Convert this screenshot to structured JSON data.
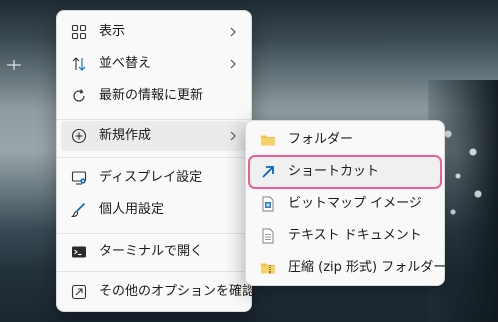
{
  "main_menu": {
    "items": [
      {
        "label": "表示",
        "icon": "view-grid-icon",
        "submenu": true
      },
      {
        "label": "並べ替え",
        "icon": "sort-icon",
        "submenu": true
      },
      {
        "label": "最新の情報に更新",
        "icon": "refresh-icon",
        "submenu": false
      },
      {
        "label": "新規作成",
        "icon": "new-plus-icon",
        "submenu": true,
        "active": true
      },
      {
        "label": "ディスプレイ設定",
        "icon": "display-settings-icon",
        "submenu": false
      },
      {
        "label": "個人用設定",
        "icon": "personalize-brush-icon",
        "submenu": false
      },
      {
        "label": "ターミナルで開く",
        "icon": "terminal-icon",
        "submenu": false
      },
      {
        "label": "その他のオプションを確認",
        "icon": "more-options-icon",
        "submenu": false
      }
    ]
  },
  "sub_menu": {
    "items": [
      {
        "label": "フォルダー",
        "icon": "folder-icon"
      },
      {
        "label": "ショートカット",
        "icon": "shortcut-arrow-icon",
        "highlighted": true
      },
      {
        "label": "ビットマップ イメージ",
        "icon": "bitmap-image-icon"
      },
      {
        "label": "テキスト ドキュメント",
        "icon": "text-document-icon"
      },
      {
        "label": "圧縮 (zip 形式) フォルダー",
        "icon": "zip-folder-icon"
      }
    ]
  },
  "colors": {
    "menu_bg": "#f9f9f9",
    "highlight_outline": "#e8609a",
    "folder": "#f2c14e",
    "accent_blue": "#0067c0"
  }
}
